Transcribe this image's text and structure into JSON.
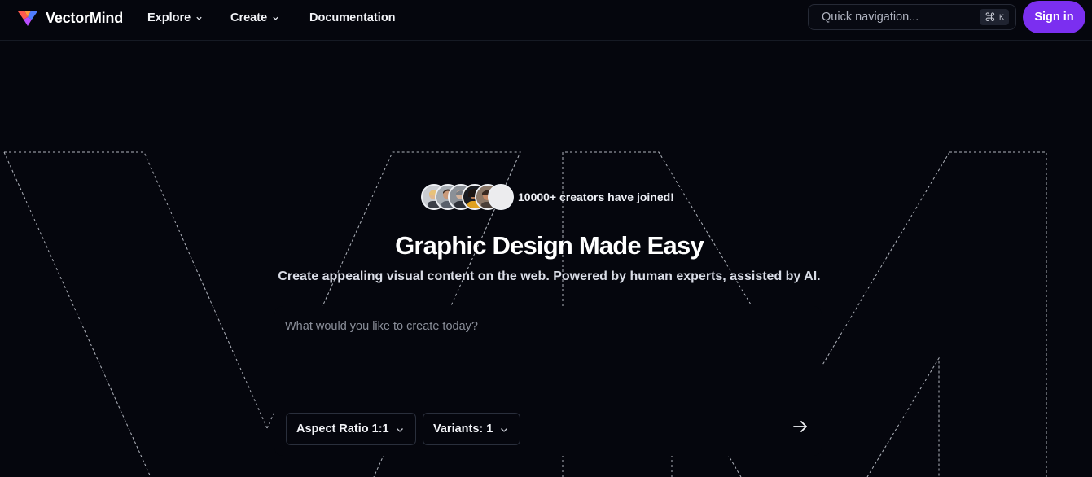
{
  "header": {
    "logo_text": "VectorMind",
    "nav": {
      "explore": "Explore",
      "create": "Create",
      "documentation": "Documentation"
    },
    "quick_nav": {
      "placeholder": "Quick navigation...",
      "shortcut_symbol": "⌘",
      "shortcut_key": "K"
    },
    "signin_label": "Sign in"
  },
  "hero": {
    "social_proof": "10000+ creators have joined!",
    "title": "Graphic Design Made Easy",
    "subtitle": "Create appealing visual content on the web. Powered by human experts, assisted by AI.",
    "prompt": {
      "placeholder": "What would you like to create today?",
      "value": ""
    },
    "aspect_ratio_label": "Aspect Ratio 1:1",
    "variants_label": "Variants: 1"
  },
  "icons": {
    "logo": "vectormind-logo-icon",
    "chevron": "chevron-down-icon",
    "submit": "arrow-right-icon",
    "command": "command-icon"
  },
  "colors": {
    "background": "#05060d",
    "accent": "#7b2ff0",
    "border": "#2a2f3c",
    "text": "#ffffff",
    "muted": "#8a8e99"
  }
}
